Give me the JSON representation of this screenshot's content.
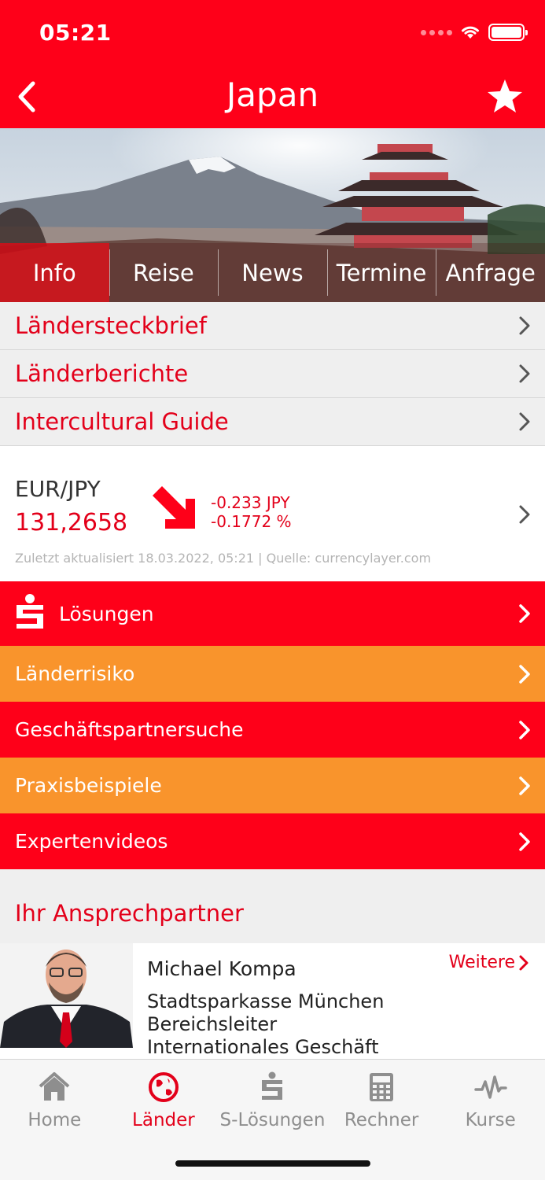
{
  "status": {
    "time": "05:21"
  },
  "header": {
    "title": "Japan"
  },
  "tabs": [
    {
      "label": "Info"
    },
    {
      "label": "Reise"
    },
    {
      "label": "News"
    },
    {
      "label": "Termine"
    },
    {
      "label": "Anfrage"
    }
  ],
  "info_links": [
    {
      "label": "Ländersteckbrief"
    },
    {
      "label": "Länderberichte"
    },
    {
      "label": "Intercultural Guide"
    }
  ],
  "currency": {
    "pair": "EUR/JPY",
    "rate": "131,2658",
    "change_abs": "-0.233 JPY",
    "change_pct": "-0.1772 %",
    "updated": "Zuletzt aktualisiert  18.03.2022, 05:21 | Quelle: currencylayer.com"
  },
  "solutions": [
    {
      "label": "Lösungen",
      "color": "#fe0019"
    },
    {
      "label": "Länderrisiko",
      "color": "#f9942c"
    },
    {
      "label": "Geschäftspartnersuche",
      "color": "#fe0019"
    },
    {
      "label": "Praxisbeispiele",
      "color": "#f9942c"
    },
    {
      "label": "Expertenvideos",
      "color": "#fe0019"
    }
  ],
  "contact": {
    "heading": "Ihr Ansprechpartner",
    "name": "Michael Kompa",
    "more_label": "Weitere",
    "org": "Stadtsparkasse München",
    "role_line1": "Bereichsleiter",
    "role_line2": "Internationales Geschäft"
  },
  "bottom_nav": [
    {
      "label": "Home",
      "icon": "home-icon"
    },
    {
      "label": "Länder",
      "icon": "globe-icon",
      "active": true
    },
    {
      "label": "S-Lösungen",
      "icon": "sparkasse-icon"
    },
    {
      "label": "Rechner",
      "icon": "calculator-icon"
    },
    {
      "label": "Kurse",
      "icon": "pulse-icon"
    }
  ],
  "colors": {
    "brand_red": "#fe0019",
    "accent_orange": "#f9942c",
    "text_red": "#e3001a"
  }
}
